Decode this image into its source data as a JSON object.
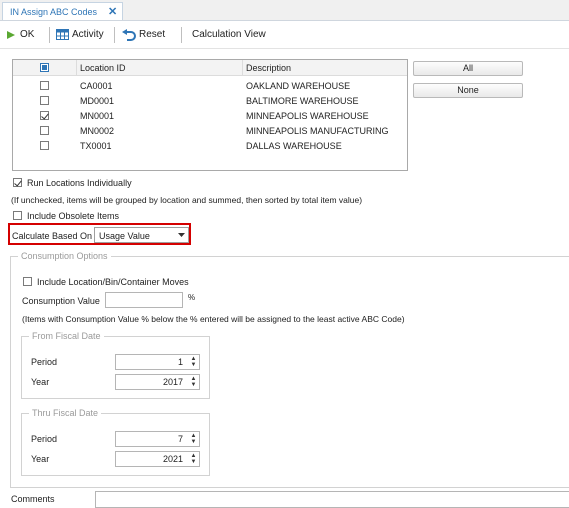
{
  "tab": {
    "label": "IN Assign ABC Codes",
    "close": "✕"
  },
  "toolbar": {
    "ok_label": "OK",
    "activity_label": "Activity",
    "reset_label": "Reset",
    "calcview_label": "Calculation View"
  },
  "grid": {
    "headers": {
      "location_id": "Location ID",
      "description": "Description"
    },
    "rows": [
      {
        "checked": false,
        "location_id": "CA0001",
        "description": "OAKLAND WAREHOUSE"
      },
      {
        "checked": false,
        "location_id": "MD0001",
        "description": "BALTIMORE WAREHOUSE"
      },
      {
        "checked": true,
        "location_id": "MN0001",
        "description": "MINNEAPOLIS WAREHOUSE"
      },
      {
        "checked": false,
        "location_id": "MN0002",
        "description": "MINNEAPOLIS MANUFACTURING"
      },
      {
        "checked": false,
        "location_id": "TX0001",
        "description": "DALLAS WAREHOUSE"
      }
    ]
  },
  "buttons": {
    "all": "All",
    "none": "None"
  },
  "options": {
    "run_individually": "Run Locations Individually",
    "run_individually_checked": true,
    "run_hint": "(If unchecked, items will be grouped by location and summed, then sorted by total item value)",
    "include_obsolete": "Include Obsolete Items",
    "include_obsolete_checked": false,
    "calc_based_on_label": "Calculate Based On",
    "calc_based_on_value": "Usage Value"
  },
  "consumption": {
    "title": "Consumption Options",
    "include_moves": "Include Location/Bin/Container Moves",
    "include_moves_checked": false,
    "value_label": "Consumption Value",
    "value": "",
    "percent": "%",
    "hint": "(Items with Consumption Value % below the % entered will be assigned to the least active ABC Code)"
  },
  "from_fiscal": {
    "title": "From Fiscal Date",
    "period_label": "Period",
    "period": "1",
    "year_label": "Year",
    "year": "2017"
  },
  "thru_fiscal": {
    "title": "Thru Fiscal Date",
    "period_label": "Period",
    "period": "7",
    "year_label": "Year",
    "year": "2021"
  },
  "comments": {
    "label": "Comments",
    "value": ""
  },
  "colors": {
    "accent": "#2e75b6",
    "highlight": "#d40000",
    "ok_green": "#4caf50"
  }
}
